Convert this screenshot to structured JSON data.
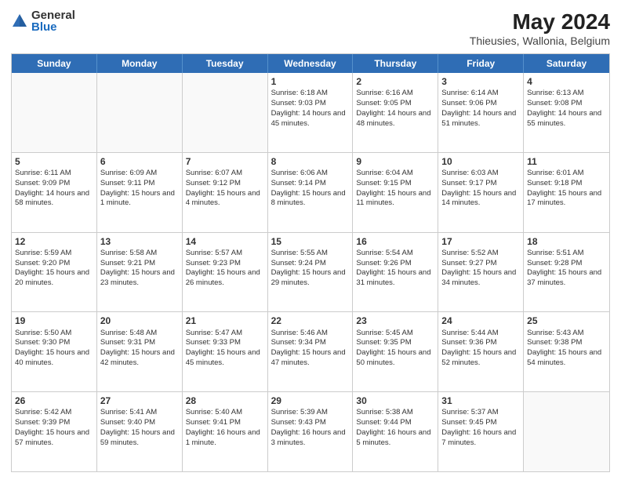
{
  "logo": {
    "general": "General",
    "blue": "Blue"
  },
  "title": {
    "month": "May 2024",
    "location": "Thieusies, Wallonia, Belgium"
  },
  "days": [
    "Sunday",
    "Monday",
    "Tuesday",
    "Wednesday",
    "Thursday",
    "Friday",
    "Saturday"
  ],
  "weeks": [
    [
      {
        "day": "",
        "sunrise": "",
        "sunset": "",
        "daylight": ""
      },
      {
        "day": "",
        "sunrise": "",
        "sunset": "",
        "daylight": ""
      },
      {
        "day": "",
        "sunrise": "",
        "sunset": "",
        "daylight": ""
      },
      {
        "day": "1",
        "sunrise": "Sunrise: 6:18 AM",
        "sunset": "Sunset: 9:03 PM",
        "daylight": "Daylight: 14 hours and 45 minutes."
      },
      {
        "day": "2",
        "sunrise": "Sunrise: 6:16 AM",
        "sunset": "Sunset: 9:05 PM",
        "daylight": "Daylight: 14 hours and 48 minutes."
      },
      {
        "day": "3",
        "sunrise": "Sunrise: 6:14 AM",
        "sunset": "Sunset: 9:06 PM",
        "daylight": "Daylight: 14 hours and 51 minutes."
      },
      {
        "day": "4",
        "sunrise": "Sunrise: 6:13 AM",
        "sunset": "Sunset: 9:08 PM",
        "daylight": "Daylight: 14 hours and 55 minutes."
      }
    ],
    [
      {
        "day": "5",
        "sunrise": "Sunrise: 6:11 AM",
        "sunset": "Sunset: 9:09 PM",
        "daylight": "Daylight: 14 hours and 58 minutes."
      },
      {
        "day": "6",
        "sunrise": "Sunrise: 6:09 AM",
        "sunset": "Sunset: 9:11 PM",
        "daylight": "Daylight: 15 hours and 1 minute."
      },
      {
        "day": "7",
        "sunrise": "Sunrise: 6:07 AM",
        "sunset": "Sunset: 9:12 PM",
        "daylight": "Daylight: 15 hours and 4 minutes."
      },
      {
        "day": "8",
        "sunrise": "Sunrise: 6:06 AM",
        "sunset": "Sunset: 9:14 PM",
        "daylight": "Daylight: 15 hours and 8 minutes."
      },
      {
        "day": "9",
        "sunrise": "Sunrise: 6:04 AM",
        "sunset": "Sunset: 9:15 PM",
        "daylight": "Daylight: 15 hours and 11 minutes."
      },
      {
        "day": "10",
        "sunrise": "Sunrise: 6:03 AM",
        "sunset": "Sunset: 9:17 PM",
        "daylight": "Daylight: 15 hours and 14 minutes."
      },
      {
        "day": "11",
        "sunrise": "Sunrise: 6:01 AM",
        "sunset": "Sunset: 9:18 PM",
        "daylight": "Daylight: 15 hours and 17 minutes."
      }
    ],
    [
      {
        "day": "12",
        "sunrise": "Sunrise: 5:59 AM",
        "sunset": "Sunset: 9:20 PM",
        "daylight": "Daylight: 15 hours and 20 minutes."
      },
      {
        "day": "13",
        "sunrise": "Sunrise: 5:58 AM",
        "sunset": "Sunset: 9:21 PM",
        "daylight": "Daylight: 15 hours and 23 minutes."
      },
      {
        "day": "14",
        "sunrise": "Sunrise: 5:57 AM",
        "sunset": "Sunset: 9:23 PM",
        "daylight": "Daylight: 15 hours and 26 minutes."
      },
      {
        "day": "15",
        "sunrise": "Sunrise: 5:55 AM",
        "sunset": "Sunset: 9:24 PM",
        "daylight": "Daylight: 15 hours and 29 minutes."
      },
      {
        "day": "16",
        "sunrise": "Sunrise: 5:54 AM",
        "sunset": "Sunset: 9:26 PM",
        "daylight": "Daylight: 15 hours and 31 minutes."
      },
      {
        "day": "17",
        "sunrise": "Sunrise: 5:52 AM",
        "sunset": "Sunset: 9:27 PM",
        "daylight": "Daylight: 15 hours and 34 minutes."
      },
      {
        "day": "18",
        "sunrise": "Sunrise: 5:51 AM",
        "sunset": "Sunset: 9:28 PM",
        "daylight": "Daylight: 15 hours and 37 minutes."
      }
    ],
    [
      {
        "day": "19",
        "sunrise": "Sunrise: 5:50 AM",
        "sunset": "Sunset: 9:30 PM",
        "daylight": "Daylight: 15 hours and 40 minutes."
      },
      {
        "day": "20",
        "sunrise": "Sunrise: 5:48 AM",
        "sunset": "Sunset: 9:31 PM",
        "daylight": "Daylight: 15 hours and 42 minutes."
      },
      {
        "day": "21",
        "sunrise": "Sunrise: 5:47 AM",
        "sunset": "Sunset: 9:33 PM",
        "daylight": "Daylight: 15 hours and 45 minutes."
      },
      {
        "day": "22",
        "sunrise": "Sunrise: 5:46 AM",
        "sunset": "Sunset: 9:34 PM",
        "daylight": "Daylight: 15 hours and 47 minutes."
      },
      {
        "day": "23",
        "sunrise": "Sunrise: 5:45 AM",
        "sunset": "Sunset: 9:35 PM",
        "daylight": "Daylight: 15 hours and 50 minutes."
      },
      {
        "day": "24",
        "sunrise": "Sunrise: 5:44 AM",
        "sunset": "Sunset: 9:36 PM",
        "daylight": "Daylight: 15 hours and 52 minutes."
      },
      {
        "day": "25",
        "sunrise": "Sunrise: 5:43 AM",
        "sunset": "Sunset: 9:38 PM",
        "daylight": "Daylight: 15 hours and 54 minutes."
      }
    ],
    [
      {
        "day": "26",
        "sunrise": "Sunrise: 5:42 AM",
        "sunset": "Sunset: 9:39 PM",
        "daylight": "Daylight: 15 hours and 57 minutes."
      },
      {
        "day": "27",
        "sunrise": "Sunrise: 5:41 AM",
        "sunset": "Sunset: 9:40 PM",
        "daylight": "Daylight: 15 hours and 59 minutes."
      },
      {
        "day": "28",
        "sunrise": "Sunrise: 5:40 AM",
        "sunset": "Sunset: 9:41 PM",
        "daylight": "Daylight: 16 hours and 1 minute."
      },
      {
        "day": "29",
        "sunrise": "Sunrise: 5:39 AM",
        "sunset": "Sunset: 9:43 PM",
        "daylight": "Daylight: 16 hours and 3 minutes."
      },
      {
        "day": "30",
        "sunrise": "Sunrise: 5:38 AM",
        "sunset": "Sunset: 9:44 PM",
        "daylight": "Daylight: 16 hours and 5 minutes."
      },
      {
        "day": "31",
        "sunrise": "Sunrise: 5:37 AM",
        "sunset": "Sunset: 9:45 PM",
        "daylight": "Daylight: 16 hours and 7 minutes."
      },
      {
        "day": "",
        "sunrise": "",
        "sunset": "",
        "daylight": ""
      }
    ]
  ]
}
